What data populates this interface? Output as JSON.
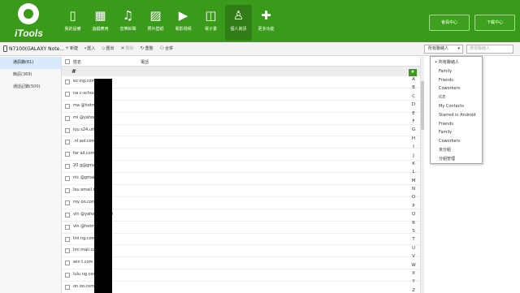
{
  "app": {
    "logo_text": "iTools"
  },
  "nav": [
    {
      "label": "我的設備",
      "icon": "phone-icon",
      "glyph": "▯"
    },
    {
      "label": "遊戲應用",
      "icon": "apps-icon",
      "glyph": "▦"
    },
    {
      "label": "音樂鈴聲",
      "icon": "music-icon",
      "glyph": "♫"
    },
    {
      "label": "照片壁紙",
      "icon": "photo-icon",
      "glyph": "▨"
    },
    {
      "label": "電影視頻",
      "icon": "video-icon",
      "glyph": "▶"
    },
    {
      "label": "電子書",
      "icon": "book-icon",
      "glyph": "◫"
    },
    {
      "label": "個人資訊",
      "icon": "person-icon",
      "glyph": "♙"
    },
    {
      "label": "更多功能",
      "icon": "more-icon",
      "glyph": "✚"
    }
  ],
  "top_buttons": {
    "member": "會員中心",
    "download": "下載中心"
  },
  "toolbar": {
    "device_name": "N7100(GALAXY Note...",
    "tools": [
      {
        "label": "新建",
        "glyph": "+",
        "disabled": false
      },
      {
        "label": "匯入",
        "glyph": "⬩",
        "disabled": false
      },
      {
        "label": "匯出",
        "glyph": "⬦",
        "disabled": false
      },
      {
        "label": "刪除",
        "glyph": "✕",
        "disabled": true
      },
      {
        "label": "重整",
        "glyph": "↻",
        "disabled": false
      },
      {
        "label": "合併",
        "glyph": "⚇",
        "disabled": false
      }
    ],
    "filter_value": "所有聯絡人",
    "search_placeholder": "搜尋聯絡人"
  },
  "sidebar": {
    "items": [
      {
        "label": "通訊錄(61)",
        "active": true
      },
      {
        "label": "簡訊(369)",
        "active": false
      },
      {
        "label": "通話記錄(500)",
        "active": false
      }
    ]
  },
  "table": {
    "col_name": "姓名",
    "col_phone": "電話",
    "group": "#",
    "rows": [
      "ez          ing.com.tw",
      "na          c-school.com",
      "ma          @hotmail.com",
      "mi          @yahoo.com.tw",
      "lou         s24.url.com.tw",
      ".nl          aol.com",
      "far          ail.com",
      "20          g@gmail.com",
      "nic          @gmail.com",
      "lou          email.tw",
      "roy          oo.com.tw",
      "vin          @yahoo.com.tw",
      "vin          @hotmail.com",
      "lini         ng.com.tw",
      "lmi          mail.com",
      "win          t.com",
      "lulu         ng.com.tw",
      "on          oo.com.tw"
    ]
  },
  "alphabet": {
    "hash": "#",
    "letters": [
      "A",
      "B",
      "C",
      "D",
      "E",
      "F",
      "G",
      "H",
      "I",
      "J",
      "K",
      "L",
      "M",
      "N",
      "O",
      "P",
      "Q",
      "R",
      "S",
      "T",
      "U",
      "V",
      "W",
      "X",
      "Y",
      "Z"
    ]
  },
  "dropdown": {
    "items": [
      {
        "label": "所有聯絡人",
        "selected": true
      },
      {
        "label": "Family",
        "selected": false
      },
      {
        "label": "Friends",
        "selected": false
      },
      {
        "label": "Coworkers",
        "selected": false
      },
      {
        "label": "ICE",
        "selected": false
      },
      {
        "label": "My Contacts",
        "selected": false
      },
      {
        "label": "Starred in Android",
        "selected": false
      },
      {
        "label": "Friends",
        "selected": false
      },
      {
        "label": "Family",
        "selected": false
      },
      {
        "label": "Coworkers",
        "selected": false
      },
      {
        "label": "未分組",
        "selected": false
      },
      {
        "label": "分組管理",
        "selected": false
      }
    ]
  },
  "colors": {
    "brand_green": "#3a9a1a",
    "active_nav": "#2f7d14",
    "sidebar_active": "#d8eafb"
  }
}
